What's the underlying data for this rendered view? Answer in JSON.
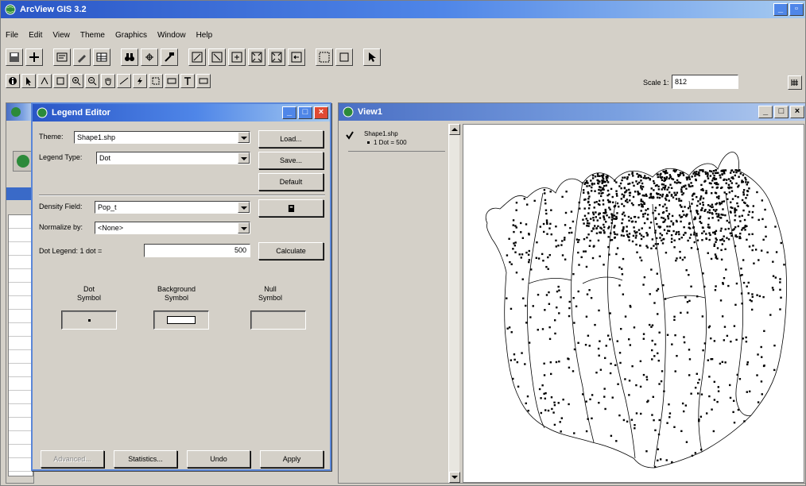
{
  "app": {
    "title": "ArcView GIS 3.2"
  },
  "menu": [
    "File",
    "Edit",
    "View",
    "Theme",
    "Graphics",
    "Window",
    "Help"
  ],
  "scale": {
    "label": "Scale 1:",
    "value": "812"
  },
  "legend_editor": {
    "title": "Legend Editor",
    "theme_label": "Theme:",
    "theme_value": "Shape1.shp",
    "legend_type_label": "Legend Type:",
    "legend_type_value": "Dot",
    "density_field_label": "Density Field:",
    "density_field_value": "Pop_t",
    "normalize_label": "Normalize by:",
    "normalize_value": "<None>",
    "dot_legend_label": "Dot Legend: 1 dot =",
    "dot_legend_value": "500",
    "buttons": {
      "load": "Load...",
      "save": "Save...",
      "default": "Default",
      "calculate": "Calculate",
      "advanced": "Advanced...",
      "statistics": "Statistics...",
      "undo": "Undo",
      "apply": "Apply"
    },
    "dot_symbol_label": "Dot\nSymbol",
    "background_symbol_label": "Background\nSymbol",
    "null_symbol_label": "Null\nSymbol"
  },
  "view": {
    "title": "View1",
    "layer_name": "Shape1.shp",
    "layer_legend": "1 Dot = 500"
  },
  "icons": [
    "globe-icon",
    "pencil-icon",
    "binoculars-icon",
    "zoom-in-icon",
    "zoom-out-icon",
    "pointer-icon",
    "text-tool-icon"
  ]
}
